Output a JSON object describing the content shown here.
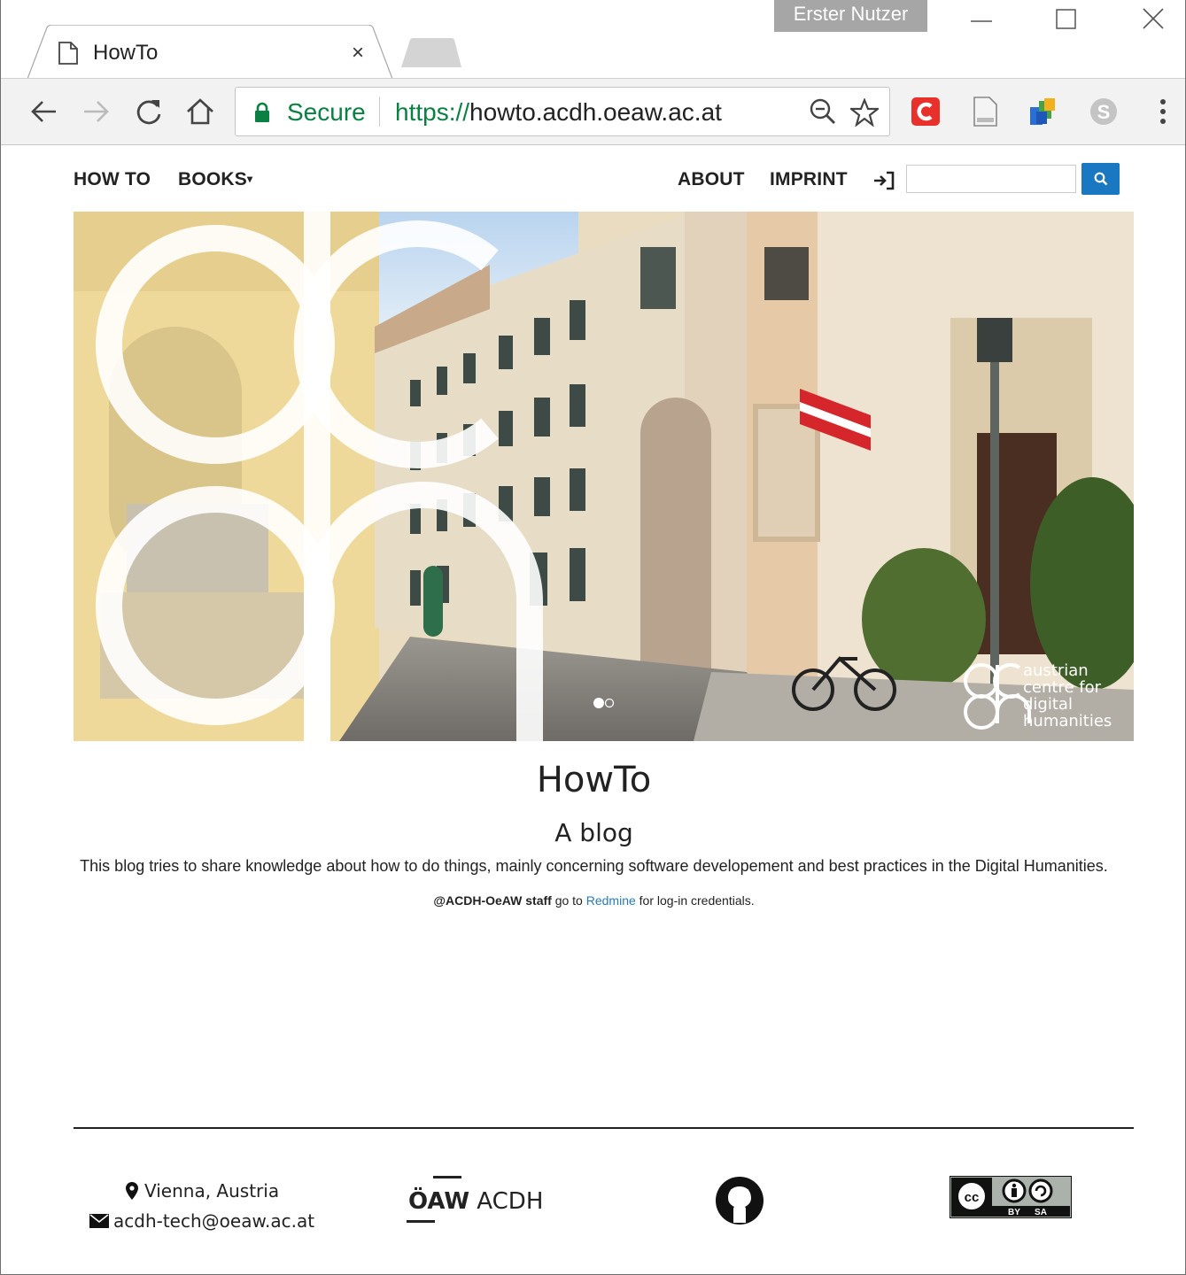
{
  "browser": {
    "tab_title": "HowTo",
    "tab_close": "×",
    "profile_name": "Erster Nutzer",
    "secure_label": "Secure",
    "url_scheme": "https://",
    "url_host": "howto.acdh.oeaw.ac.at",
    "icons": [
      "page-icon",
      "back-arrow-icon",
      "forward-arrow-icon",
      "reload-icon",
      "home-icon",
      "lock-icon",
      "zoom-out-icon",
      "star-icon",
      "extension-c-icon",
      "document-icon",
      "extension-puzzle-icon",
      "skype-icon",
      "menu-dots-icon",
      "minimize-icon",
      "maximize-icon",
      "close-icon"
    ]
  },
  "nav": {
    "howto": "HOW TO",
    "books": "BOOKS",
    "books_caret": "▾",
    "about": "ABOUT",
    "imprint": "IMPRINT",
    "login_icon": "login-icon",
    "search_placeholder": ""
  },
  "hero": {
    "logo_lines": [
      "austrian",
      "centre for",
      "digital",
      "humanities"
    ]
  },
  "main": {
    "title": "HowTo",
    "subtitle": "A blog",
    "description": "This blog tries to share knowledge about how to do things, mainly concerning software developement and best practices in the Digital Humanities.",
    "staff_bold": "@ACDH-OeAW staff",
    "staff_pre": " go to ",
    "staff_link": "Redmine",
    "staff_post": " for log-in credentials."
  },
  "footer": {
    "location": "Vienna, Austria",
    "email": "acdh-tech@oeaw.ac.at",
    "oeaw_bold": "ÖAW",
    "oeaw_rest": " ACDH",
    "cc_by": "BY",
    "cc_sa": "SA"
  },
  "colors": {
    "accent": "#1a78c2",
    "secure_green": "#0b8043",
    "link": "#2a7ab0"
  }
}
